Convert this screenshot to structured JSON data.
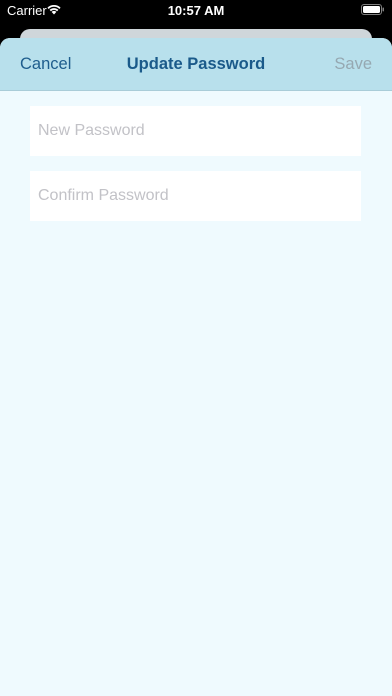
{
  "status": {
    "carrier": "Carrier",
    "time": "10:57 AM"
  },
  "nav": {
    "cancel": "Cancel",
    "title": "Update Password",
    "save": "Save"
  },
  "form": {
    "new_password_placeholder": "New Password",
    "confirm_password_placeholder": "Confirm Password"
  },
  "colors": {
    "nav_bg": "#b8e0ec",
    "sheet_bg": "#effafe",
    "accent": "#1e5d8d",
    "disabled": "#96a8b1"
  },
  "icons": [
    "wifi-icon",
    "battery-icon"
  ]
}
